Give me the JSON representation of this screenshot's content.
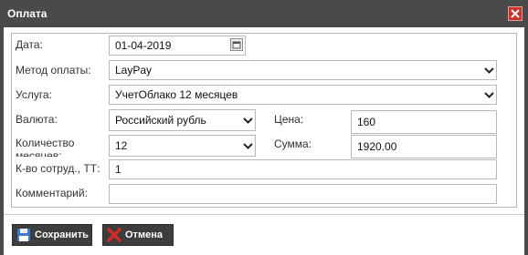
{
  "dialog": {
    "title": "Оплата"
  },
  "form": {
    "date": {
      "label": "Дата:",
      "value": "01-04-2019"
    },
    "payment_method": {
      "label": "Метод оплаты:",
      "value": "LayPay"
    },
    "service": {
      "label": "Услуга:",
      "value": "УчетОблако 12 месяцев"
    },
    "currency": {
      "label": "Валюта:",
      "value": "Российский рубль"
    },
    "price": {
      "label": "Цена:",
      "value": "160"
    },
    "months_count": {
      "label": "Количество месяцев:",
      "value": "12"
    },
    "sum": {
      "label": "Сумма:",
      "value": "1920.00"
    },
    "employees": {
      "label": "К-во сотруд., ТТ:",
      "value": "1"
    },
    "comment": {
      "label": "Комментарий:",
      "value": ""
    }
  },
  "buttons": {
    "save": "Сохранить",
    "cancel": "Отмена"
  },
  "icons": {
    "close": "close-icon",
    "calendar": "calendar-icon",
    "dropdown": "chevron-down-icon",
    "save": "floppy-disk-icon",
    "cancel": "red-x-icon"
  },
  "colors": {
    "titlebar": "#4a4a4a",
    "close": "#c8332c",
    "button": "#3d3d3d",
    "cancel_icon": "#d42a2a"
  }
}
